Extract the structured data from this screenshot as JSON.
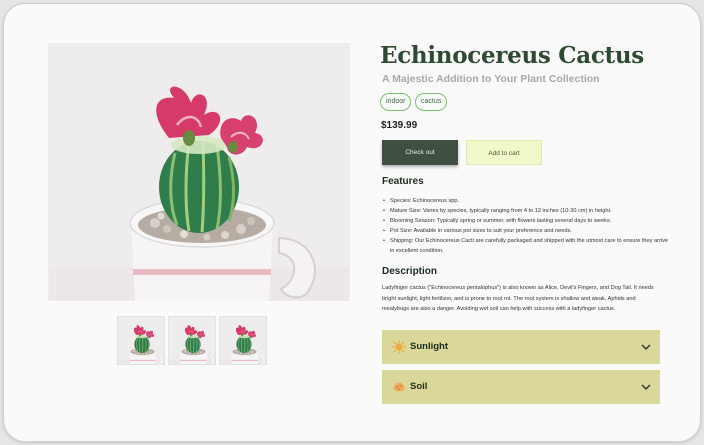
{
  "product": {
    "title": "Echinocereus Cactus",
    "subtitle": "A Majestic Addition to Your Plant Collection",
    "tags": [
      "indoor",
      "cactus"
    ],
    "price": "$139.99"
  },
  "actions": {
    "checkout_label": "Check out",
    "cart_label": "Add to cart"
  },
  "features": {
    "heading": "Features",
    "items": [
      "Species: Echinocereus spp.",
      "Mature Size: Varies by species, typically ranging from 4 to 12 inches (10-30 cm) in height.",
      "Blooming Season: Typically spring or summer, with flowers lasting several days to weeks.",
      "Pot Size: Available in various pot sizes to suit your preference and needs.",
      "Shipping: Our Echinocereus Cacti are carefully packaged and shipped with the utmost care to ensure they arrive in excellent condition."
    ]
  },
  "description": {
    "heading": "Description",
    "text": "Ladyfinger cactus (\"Echinocereus pentalophus\") is also known as Alice, Devil's Fingers, and Dog Tail. It needs bright sunlight, light fertilizer, and is prone to root rot. The root system is shallow and weak. Aphids and mealybugs are also a danger. Avoiding wet soil can help with success with a ladyfinger cactus."
  },
  "accordions": [
    {
      "label": "Sunlight",
      "icon": "sun-icon"
    },
    {
      "label": "Soil",
      "icon": "soil-icon"
    }
  ],
  "colors": {
    "brand_green": "#2f4a32",
    "checkout_bg": "#3f4f42",
    "cart_bg": "#f0f9c9",
    "accordion_bg": "#d9d89a",
    "tag_border": "#7cbf70"
  }
}
